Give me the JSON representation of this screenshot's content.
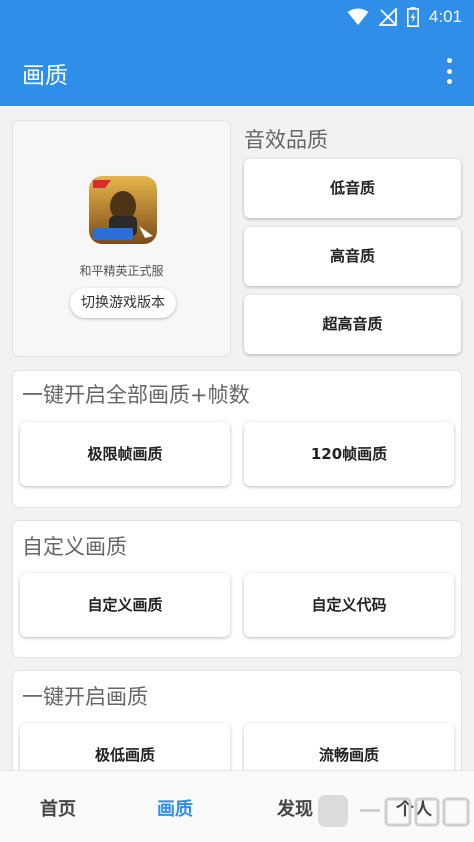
{
  "status_bar": {
    "time": "4:01"
  },
  "app_bar": {
    "title": "画质"
  },
  "game_card": {
    "name": "和平精英正式服",
    "switch_label": "切换游戏版本"
  },
  "sound_section": {
    "title": "音效品质",
    "buttons": [
      "低音质",
      "高音质",
      "超高音质"
    ]
  },
  "onekey_section": {
    "title": "一键开启全部画质+帧数",
    "buttons": [
      "极限帧画质",
      "120帧画质"
    ]
  },
  "custom_section": {
    "title": "自定义画质",
    "buttons": [
      "自定义画质",
      "自定义代码"
    ]
  },
  "quality_section": {
    "title": "一键开启画质",
    "buttons": [
      "极低画质",
      "流畅画质"
    ]
  },
  "tabs": [
    {
      "label": "首页",
      "active": false
    },
    {
      "label": "画质",
      "active": true
    },
    {
      "label": "发现",
      "active": false
    },
    {
      "label": "个人",
      "active": false
    }
  ],
  "colors": {
    "accent": "#2f8fe8",
    "background": "#f2f2f2"
  }
}
